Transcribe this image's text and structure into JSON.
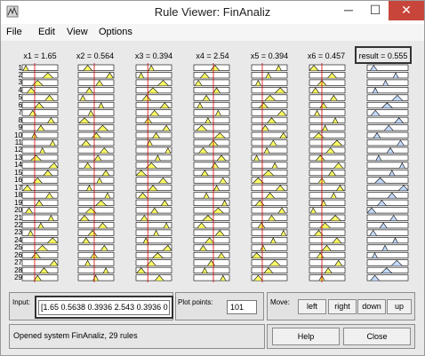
{
  "window": {
    "title": "Rule Viewer: FinAnaliz",
    "controls": {
      "minimize": "─",
      "maximize": "☐",
      "close": "✕"
    }
  },
  "menu": [
    "File",
    "Edit",
    "View",
    "Options"
  ],
  "inputs": [
    {
      "label": "x1 = 1.65"
    },
    {
      "label": "x2 = 0.564"
    },
    {
      "label": "x3 = 0.394"
    },
    {
      "label": "x4 = 2.54"
    },
    {
      "label": "x5 = 0.394"
    },
    {
      "label": "x6 = 0.457"
    }
  ],
  "output": {
    "label": "result = 0.555"
  },
  "rules": {
    "count": 29
  },
  "controls": {
    "input_label": "Input:",
    "input_value": "[1.65 0.5638 0.3936 2.543 0.3936 0",
    "plot_points_label": "Plot points:",
    "plot_points_value": "101",
    "move_label": "Move:",
    "move_buttons": [
      "left",
      "right",
      "down",
      "up"
    ],
    "help_label": "Help",
    "close_label": "Close"
  },
  "status_text": "Opened system FinAnaliz, 29 rules",
  "colors": {
    "titlebar_close": "#c7453a",
    "panel": "#e9e9e9",
    "fill": "#ffff00",
    "line": "#000000"
  }
}
